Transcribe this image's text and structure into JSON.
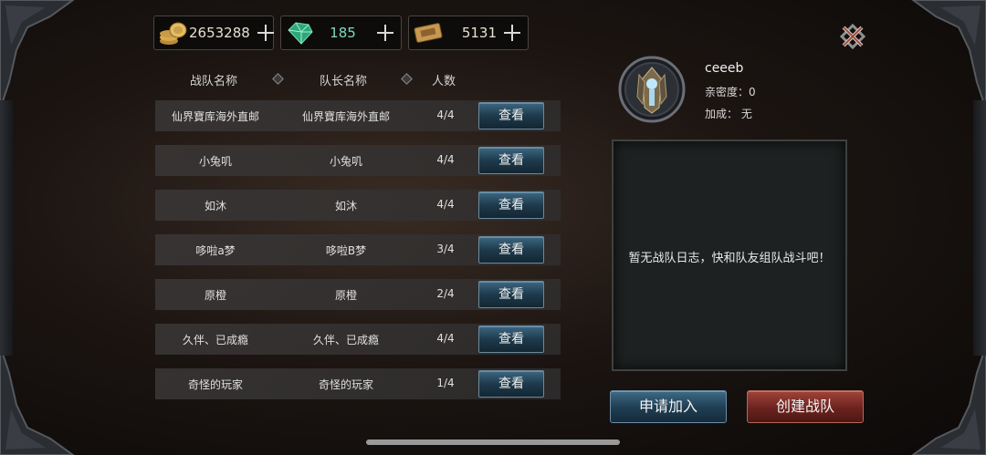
{
  "currency": {
    "gold": "2653288",
    "gems": "185",
    "tickets": "5131"
  },
  "table": {
    "headers": [
      "战队名称",
      "队长名称",
      "人数"
    ],
    "rows": [
      {
        "team": "仙界寶库海外直邮",
        "leader": "仙界寶库海外直邮",
        "members": "4/4",
        "action": "查看"
      },
      {
        "team": "小兔叽",
        "leader": "小兔叽",
        "members": "4/4",
        "action": "查看"
      },
      {
        "team": "如沐",
        "leader": "如沐",
        "members": "4/4",
        "action": "查看"
      },
      {
        "team": "哆啦a梦",
        "leader": "哆啦B梦",
        "members": "3/4",
        "action": "查看"
      },
      {
        "team": "原橙",
        "leader": "原橙",
        "members": "2/4",
        "action": "查看"
      },
      {
        "team": "久伴、已成瘾",
        "leader": "久伴、已成瘾",
        "members": "4/4",
        "action": "查看"
      },
      {
        "team": "奇怪的玩家",
        "leader": "奇怪的玩家",
        "members": "1/4",
        "action": "查看"
      }
    ]
  },
  "profile": {
    "name": "ceeeb",
    "intimacy": "亲密度：0",
    "bonus": "加成：  无"
  },
  "log": {
    "empty_text": "暂无战队日志，快和队友组队战斗吧！"
  },
  "actions": {
    "join": "申请加入",
    "create": "创建战队"
  }
}
